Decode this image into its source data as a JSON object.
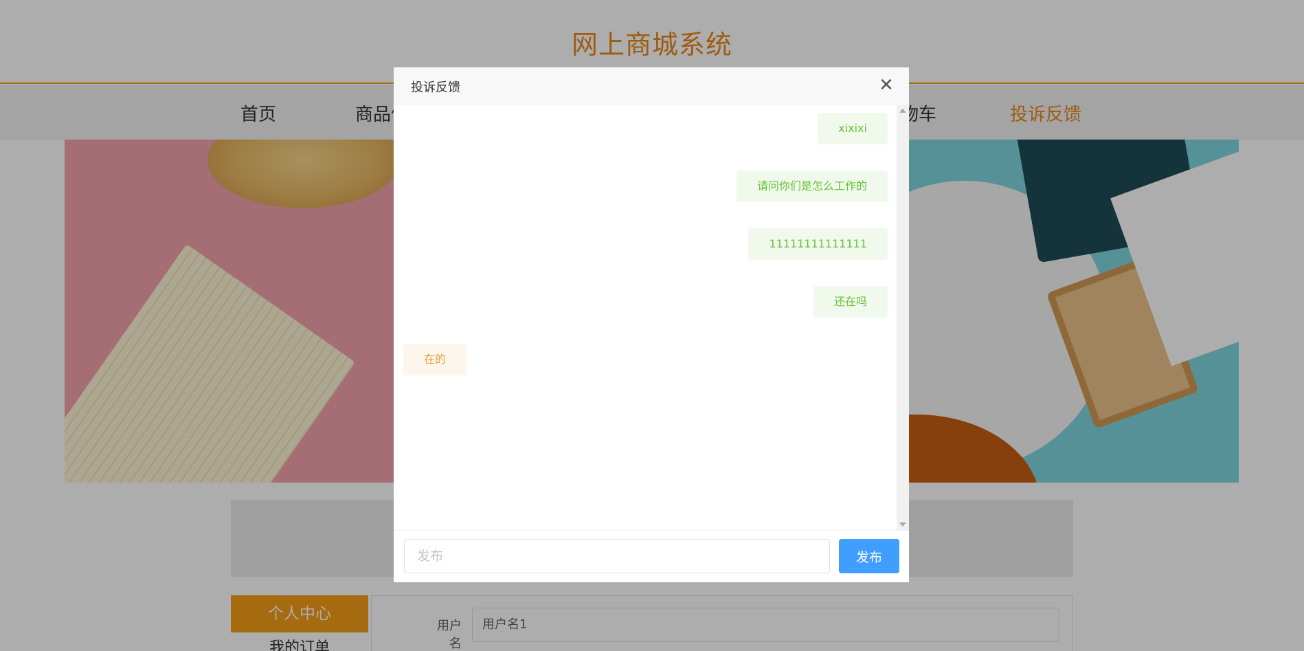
{
  "site": {
    "title": "网上商城系统"
  },
  "nav": {
    "items": [
      {
        "label": "首页"
      },
      {
        "label": "商品信息"
      },
      {
        "label": "购物车"
      },
      {
        "label": "投诉反馈"
      }
    ],
    "active_index": 3
  },
  "sidebar": {
    "title": "个人中心",
    "items": [
      {
        "label": "我的订单"
      }
    ]
  },
  "profile_form": {
    "username_label": "用户名",
    "username_value": "用户名1"
  },
  "dialog": {
    "title": "投诉反馈",
    "close_icon": "close-icon",
    "messages": [
      {
        "text": "xixixi",
        "side": "right"
      },
      {
        "text": "请问你们是怎么工作的",
        "side": "right"
      },
      {
        "text": "11111111111111",
        "side": "right"
      },
      {
        "text": "还在吗",
        "side": "right"
      },
      {
        "text": "在的",
        "side": "left"
      }
    ],
    "input_placeholder": "发布",
    "input_value": "",
    "submit_label": "发布"
  },
  "colors": {
    "accent": "#f59c17",
    "title": "#e8881a",
    "primary_button": "#409eff",
    "user_bubble_bg": "#f0f9eb",
    "user_bubble_text": "#67c23a",
    "reply_bubble_bg": "#fdf6ec",
    "reply_bubble_text": "#e6a23c"
  }
}
